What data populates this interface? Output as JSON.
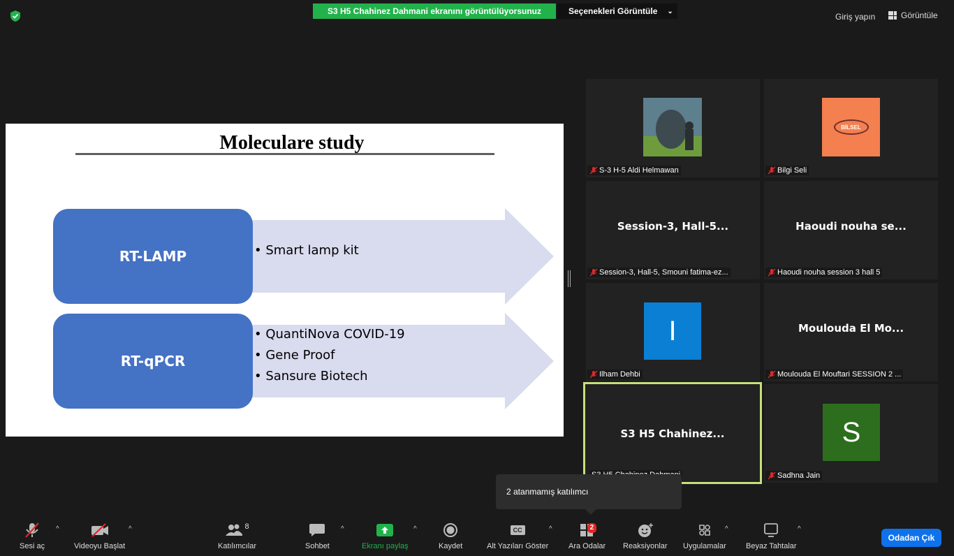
{
  "topbar": {
    "share_banner": "S3 H5 Chahinez Dahmani ekranını görüntülüyorsunuz",
    "view_options": "Seçenekleri Görüntüle",
    "signin": "Giriş yapın",
    "view": "Görüntüle"
  },
  "slide": {
    "title": "Moleculare study",
    "rows": [
      {
        "label": "RT-LAMP",
        "bullets": [
          "Smart lamp kit"
        ]
      },
      {
        "label": "RT-qPCR",
        "bullets": [
          "QuantiNova COVID-19",
          "Gene Proof",
          "Sansure Biotech"
        ]
      }
    ]
  },
  "gallery": {
    "tiles": [
      {
        "name": "S-3 H-5 Aldi Helmawan",
        "muted": true
      },
      {
        "name": "Bilgi Seli",
        "muted": true,
        "logo_text": "BİLSEL"
      },
      {
        "display": "Session-3, Hall-5...",
        "name": "Session-3, Hall-5, Smouni fatima-ez...",
        "muted": true
      },
      {
        "display": "Haoudi nouha se...",
        "name": "Haoudi nouha session 3 hall 5",
        "muted": true
      },
      {
        "avatar_letter": "I",
        "name": "Ilham Dehbi",
        "muted": true,
        "color": "#0b7fd4"
      },
      {
        "display": "Moulouda El Mo...",
        "name": "Moulouda El Mouftari SESSION 2 ...",
        "muted": true
      },
      {
        "display": "S3 H5 Chahinez...",
        "name": "S3 H5 Chahinez Dahmani",
        "muted": false,
        "active": true
      },
      {
        "avatar_letter": "S",
        "name": "Sadhna Jain",
        "muted": true,
        "color": "#2d6e1e"
      }
    ]
  },
  "tooltip": "2 atanmamış katılımcı",
  "toolbar": {
    "audio": "Sesi aç",
    "video": "Videoyu Başlat",
    "participants": "Katılımcılar",
    "participants_count": "8",
    "chat": "Sohbet",
    "share": "Ekranı paylaş",
    "record": "Kaydet",
    "captions": "Alt Yazıları Göster",
    "captions_icon": "CC",
    "breakout": "Ara Odalar",
    "breakout_badge": "2",
    "reactions": "Reaksiyonlar",
    "apps": "Uygulamalar",
    "whiteboards": "Beyaz Tahtalar",
    "leave": "Odadan Çık"
  },
  "colors": {
    "accent_green": "#22b24c",
    "box_blue": "#4472c4",
    "leave_blue": "#0e72ed",
    "active_border": "#c5e07a",
    "muted_red": "#e02828"
  }
}
